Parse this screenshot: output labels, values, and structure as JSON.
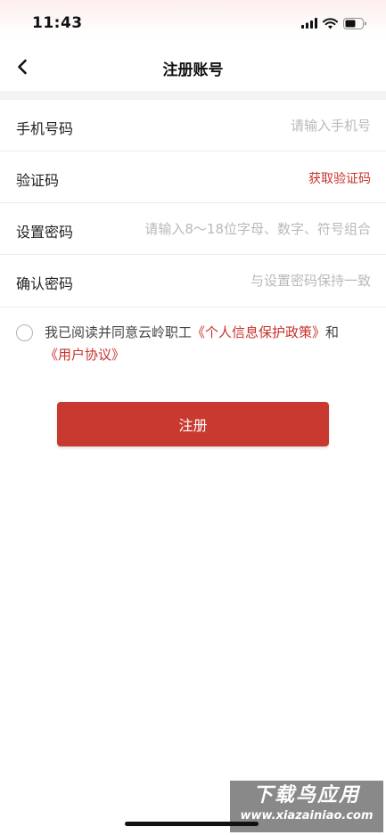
{
  "status_bar": {
    "time": "11:43",
    "icons": [
      "signal-icon",
      "wifi-icon",
      "battery-icon"
    ]
  },
  "nav": {
    "back_icon": "chevron-left-icon",
    "title": "注册账号"
  },
  "form": {
    "phone": {
      "label": "手机号码",
      "placeholder": "请输入手机号",
      "value": ""
    },
    "code": {
      "label": "验证码",
      "get_code_label": "获取验证码",
      "value": ""
    },
    "password": {
      "label": "设置密码",
      "placeholder": "请输入8～18位字母、数字、符号组合",
      "value": ""
    },
    "confirm": {
      "label": "确认密码",
      "placeholder": "与设置密码保持一致",
      "value": ""
    }
  },
  "agreement": {
    "prefix": "我已阅读并同意云岭职工",
    "privacy_link": "《个人信息保护政策》",
    "conjunction": "和",
    "terms_link": "《用户协议》",
    "checked": false
  },
  "actions": {
    "register_label": "注册"
  },
  "watermark": {
    "title": "下载鸟应用",
    "url": "www.xiazainiao.com"
  },
  "colors": {
    "accent": "#c8392f",
    "link": "#c8322c",
    "placeholder": "#b9b9b9"
  }
}
